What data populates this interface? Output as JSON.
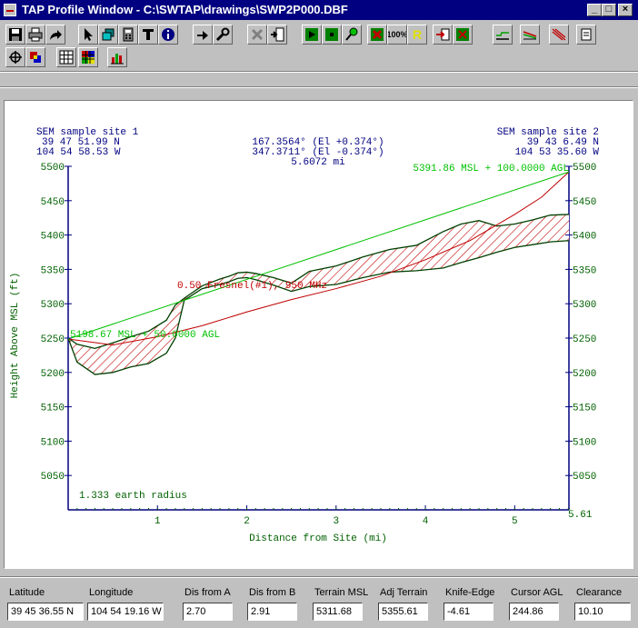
{
  "window": {
    "title": "TAP Profile Window - C:\\SWTAP\\drawings\\SWP2P000.DBF",
    "minimize_glyph": "_",
    "maximize_glyph": "□",
    "close_glyph": "×"
  },
  "toolbar": {
    "row1": [
      "save-icon",
      "print-icon",
      "export-arrow-icon",
      "pointer-icon",
      "layers-icon",
      "calculator-icon",
      "text-tool-icon",
      "info-icon",
      "zoom-hand-icon",
      "wrench-icon",
      "delete-x-icon",
      "insert-page-icon",
      "play-icon",
      "stop-icon",
      "map-pin-icon",
      "cancel-icon",
      "zoom-100-icon",
      "r-marker-icon",
      "red-arrow-icon",
      "green-cross-icon",
      "flat-line-icon",
      "slope-icon",
      "fresnel-icon",
      "note-icon"
    ],
    "row2": [
      "crosshair-icon",
      "color-layers-icon",
      "grid-icon",
      "color-grid-icon",
      "bar-chart-icon"
    ],
    "zoom_label": "100%",
    "r_label": "R"
  },
  "profile": {
    "site1": {
      "name": "SEM sample site 1",
      "lat": "39 47 51.99 N",
      "lon": "104 54 58.53 W"
    },
    "site2": {
      "name": "SEM sample site 2",
      "lat": "39 43 6.49 N",
      "lon": "104 53 35.60 W"
    },
    "azimuth1": "167.3564° (El +0.374°)",
    "azimuth2": "347.3711° (El -0.374°)",
    "distance": "5.6072 mi",
    "right_antenna": "5391.86 MSL + 100.0000 AGL",
    "left_antenna": "5198.67 MSL + 50.0000 AGL",
    "fresnel_label": "0.50 Fresnel(#1), 950 MHz",
    "earth_radius": "1.333 earth radius",
    "colors": {
      "text_blue": "#000080",
      "axis_green": "#006000",
      "los_green": "#00c000",
      "fresnel_red": "#c00000",
      "terrain": "#004000"
    }
  },
  "chart_data": {
    "type": "line",
    "xlabel": "Distance from Site (mi)",
    "ylabel": "Height Above MSL (ft)",
    "xlim": [
      0,
      5.6072
    ],
    "ylim": [
      5000,
      5500
    ],
    "xticks": [
      1,
      2,
      3,
      4,
      5
    ],
    "yticks": [
      5050,
      5100,
      5150,
      5200,
      5250,
      5300,
      5350,
      5400,
      5450,
      5500
    ],
    "xtick_labels": [
      "1",
      "2",
      "3",
      "4",
      "5"
    ],
    "ytick_labels": [
      "5050",
      "5100",
      "5150",
      "5200",
      "5250",
      "5300",
      "5350",
      "5400",
      "5450",
      "5500"
    ],
    "corner_label": "5.61",
    "series": [
      {
        "role": "terrain",
        "x": [
          0,
          0.1,
          0.3,
          0.5,
          0.7,
          0.9,
          1.1,
          1.2,
          1.3,
          1.5,
          1.7,
          1.8,
          1.9,
          2.0,
          2.1,
          2.3,
          2.5,
          2.7,
          3.0,
          3.3,
          3.6,
          3.9,
          4.2,
          4.4,
          4.6,
          4.8,
          5.0,
          5.2,
          5.4,
          5.6072
        ],
        "values": [
          5250,
          5215,
          5197,
          5200,
          5208,
          5213,
          5228,
          5250,
          5305,
          5322,
          5328,
          5332,
          5337,
          5338,
          5335,
          5327,
          5318,
          5325,
          5328,
          5338,
          5346,
          5348,
          5352,
          5360,
          5367,
          5375,
          5382,
          5386,
          5390,
          5391.86
        ]
      },
      {
        "role": "terrain_adjusted",
        "x": [
          0,
          0.1,
          0.3,
          0.5,
          0.7,
          0.9,
          1.1,
          1.2,
          1.3,
          1.5,
          1.7,
          1.8,
          1.9,
          2.0,
          2.1,
          2.3,
          2.5,
          2.7,
          3.0,
          3.3,
          3.6,
          3.9,
          4.2,
          4.4,
          4.6,
          4.8,
          5.0,
          5.2,
          5.4,
          5.6072
        ],
        "values": [
          5250,
          5241,
          5235,
          5243,
          5252,
          5260,
          5276,
          5298,
          5308,
          5326,
          5336,
          5340,
          5345,
          5346,
          5344,
          5338,
          5330,
          5347,
          5355,
          5368,
          5379,
          5385,
          5405,
          5416,
          5421,
          5413,
          5416,
          5422,
          5429,
          5430
        ]
      },
      {
        "role": "fresnel_zone",
        "x": [
          0,
          0.5,
          1.0,
          1.5,
          2.0,
          2.5,
          3.0,
          3.5,
          4.0,
          4.5,
          5.0,
          5.3,
          5.6072
        ],
        "values": [
          5248.67,
          5240,
          5252,
          5268,
          5288,
          5306,
          5322,
          5340,
          5364,
          5392,
          5430,
          5455,
          5491.86
        ]
      },
      {
        "role": "line_of_sight",
        "x": [
          0,
          5.6072
        ],
        "values": [
          5248.67,
          5491.86
        ]
      }
    ]
  },
  "status": {
    "fields": [
      {
        "label": "Latitude",
        "value": "39 45 36.55 N"
      },
      {
        "label": "Longitude",
        "value": "104 54 19.16 W"
      },
      {
        "label": "Dis from A",
        "value": "2.70"
      },
      {
        "label": "Dis from B",
        "value": "2.91"
      },
      {
        "label": "Terrain MSL",
        "value": "5311.68"
      },
      {
        "label": "Adj Terrain",
        "value": "5355.61"
      },
      {
        "label": "Knife-Edge",
        "value": "-4.61"
      },
      {
        "label": "Cursor AGL",
        "value": "244.86"
      },
      {
        "label": "Clearance",
        "value": "10.10"
      }
    ]
  }
}
